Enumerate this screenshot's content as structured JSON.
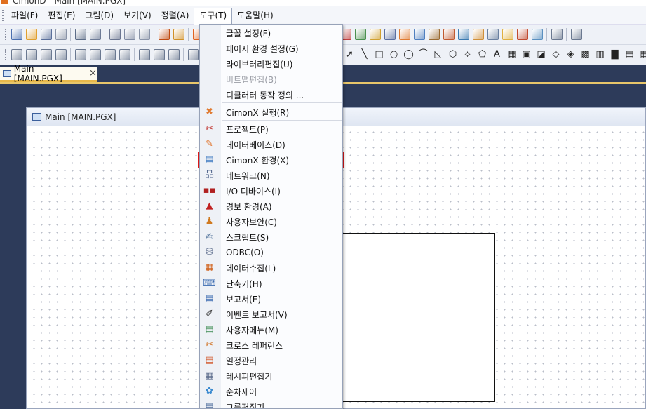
{
  "app": {
    "title": "CimonD - Main [MAIN.PGX]"
  },
  "menubar": {
    "items": [
      "파일(F)",
      "편집(E)",
      "그림(D)",
      "보기(V)",
      "정렬(A)",
      "도구(T)",
      "도움말(H)"
    ],
    "active_index": 5
  },
  "document_tab": {
    "label": "Main [MAIN.PGX]",
    "close": "×"
  },
  "child_window": {
    "title": "Main [MAIN.PGX]"
  },
  "tools_menu": {
    "items": [
      {
        "label": "글꼴 설정(F)",
        "icon": "none",
        "enabled": true
      },
      {
        "label": "페이지 환경 설정(G)",
        "icon": "none",
        "enabled": true
      },
      {
        "label": "라이브러리편집(U)",
        "icon": "none",
        "enabled": true
      },
      {
        "label": "비트맵편집(B)",
        "icon": "none",
        "enabled": false
      },
      {
        "label": "디클러터 동작 정의 ...",
        "icon": "none",
        "enabled": true
      },
      {
        "label": "CimonX 실행(R)",
        "icon": "cimonx-run-icon",
        "enabled": true
      },
      {
        "label": "프로젝트(P)",
        "icon": "project-tools-icon",
        "enabled": true
      },
      {
        "label": "데이터베이스(D)",
        "icon": "database-pencil-icon",
        "enabled": true
      },
      {
        "label": "CimonX 환경(X)",
        "icon": "cimonx-settings-icon",
        "enabled": true,
        "highlighted": true
      },
      {
        "label": "네트워크(N)",
        "icon": "network-icon",
        "enabled": true
      },
      {
        "label": "I/O 디바이스(I)",
        "icon": "io-device-icon",
        "enabled": true
      },
      {
        "label": "경보 환경(A)",
        "icon": "alarm-icon",
        "enabled": true
      },
      {
        "label": "사용자보안(C)",
        "icon": "user-security-icon",
        "enabled": true
      },
      {
        "label": "스크립트(S)",
        "icon": "script-icon",
        "enabled": true
      },
      {
        "label": "ODBC(O)",
        "icon": "odbc-icon",
        "enabled": true
      },
      {
        "label": "데이터수집(L)",
        "icon": "data-collection-icon",
        "enabled": true
      },
      {
        "label": "단축키(H)",
        "icon": "shortcut-key-icon",
        "enabled": true
      },
      {
        "label": "보고서(E)",
        "icon": "report-icon",
        "enabled": true
      },
      {
        "label": "이벤트 보고서(V)",
        "icon": "event-report-icon",
        "enabled": true
      },
      {
        "label": "사용자메뉴(M)",
        "icon": "user-menu-icon",
        "enabled": true
      },
      {
        "label": "크로스 레퍼런스",
        "icon": "cross-reference-icon",
        "enabled": true
      },
      {
        "label": "일정관리",
        "icon": "schedule-icon",
        "enabled": true
      },
      {
        "label": "레시피편집기",
        "icon": "recipe-editor-icon",
        "enabled": true
      },
      {
        "label": "순차제어",
        "icon": "sequence-control-icon",
        "enabled": true
      },
      {
        "label": "그룹편집기",
        "icon": "group-editor-icon",
        "enabled": true
      }
    ]
  },
  "colors": {
    "mdi_background": "#2d3b5a",
    "highlight_border": "#e01818",
    "tab_accent": "#e8b84a"
  }
}
